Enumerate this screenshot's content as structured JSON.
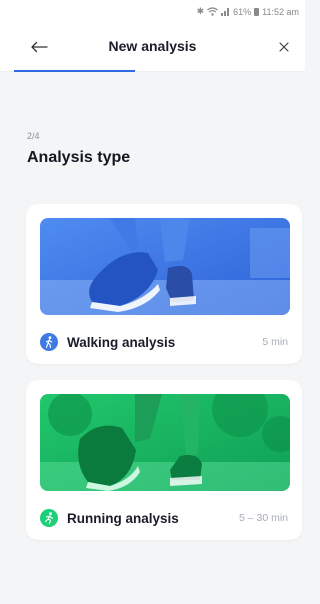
{
  "status_bar": {
    "battery": "61%",
    "time": "11:52 am",
    "icons": [
      "bluetooth-icon",
      "wifi-icon",
      "signal-icon",
      "battery-icon"
    ]
  },
  "header": {
    "title": "New analysis",
    "back_icon": "arrow-left-icon",
    "close_icon": "close-icon",
    "progress": 0.5
  },
  "step": {
    "counter": "2/4",
    "heading": "Analysis type"
  },
  "options": [
    {
      "label": "Walking analysis",
      "duration": "5 min",
      "icon": "walking-person-icon",
      "image": "walking-feet-photo",
      "accent": "#3d7be3"
    },
    {
      "label": "Running analysis",
      "duration": "5 – 30 min",
      "icon": "running-person-icon",
      "image": "running-feet-photo",
      "accent": "#1ecf7a"
    }
  ],
  "colors": {
    "primary": "#2f6be0",
    "background": "#f4f5f7",
    "card": "#ffffff"
  }
}
